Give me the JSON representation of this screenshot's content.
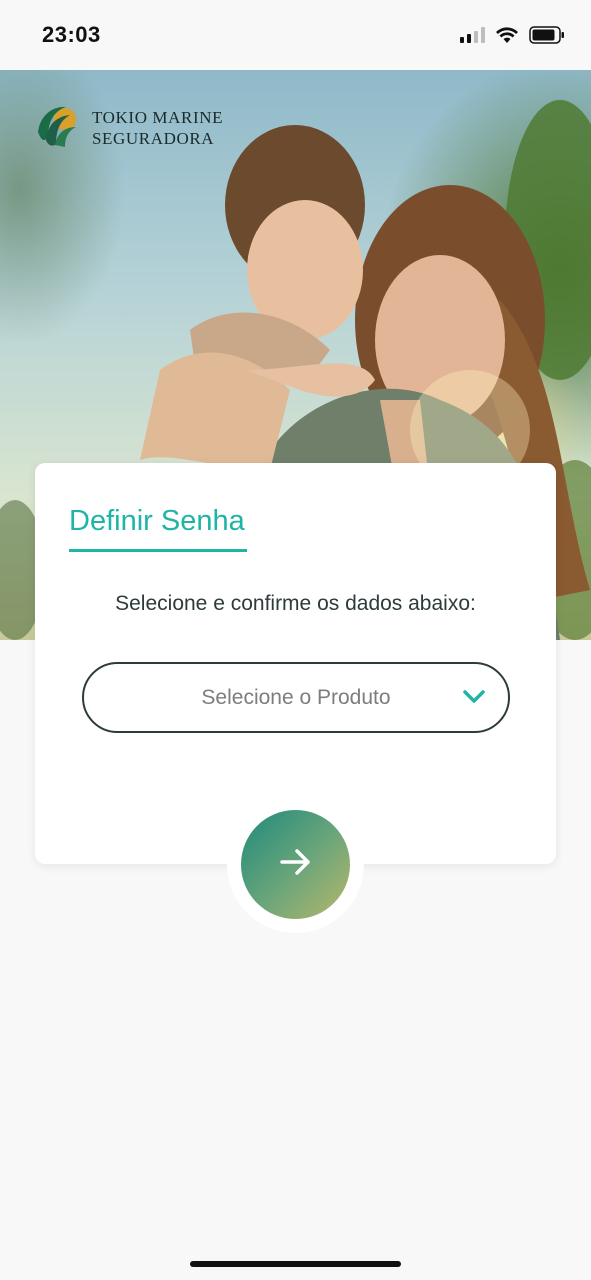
{
  "status_bar": {
    "time": "23:03",
    "signal_bars_active": 2,
    "signal_bars_total": 4,
    "battery_level": 0.85
  },
  "brand": {
    "line1": "TOKIO MARINE",
    "line2": "SEGURADORA",
    "logo_icon": "tokio-marine-logo-icon"
  },
  "card": {
    "title": "Definir Senha",
    "instructions": "Selecione e confirme os dados abaixo:",
    "product_select": {
      "placeholder": "Selecione o Produto",
      "icon": "chevron-down-icon"
    }
  },
  "next_button": {
    "icon": "arrow-right-icon"
  },
  "colors": {
    "accent": "#1fb5a6",
    "button_gradient_start": "#1e8a7c",
    "button_gradient_end": "#b8b76a",
    "outline": "#2c3b3b"
  }
}
